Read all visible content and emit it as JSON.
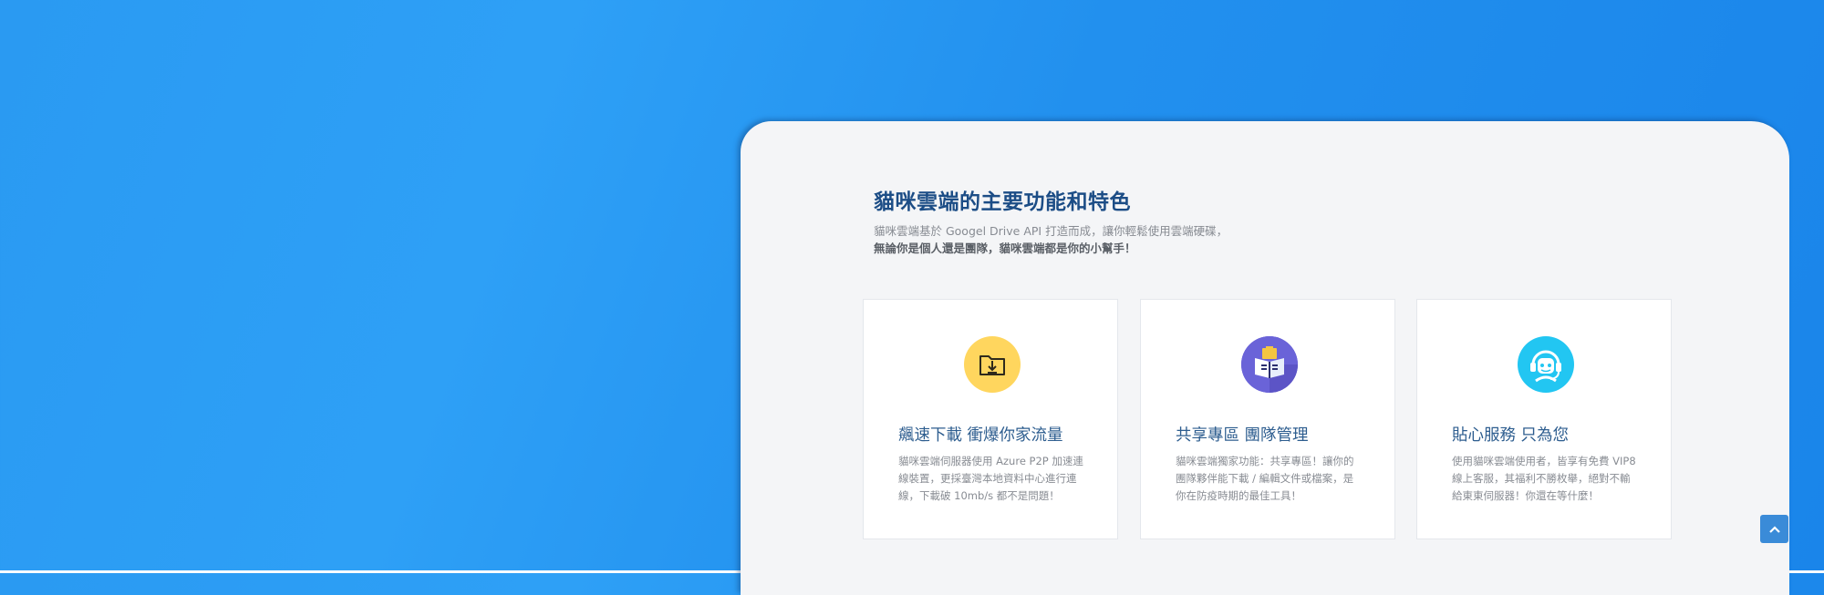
{
  "features": {
    "heading": "貓咪雲端的主要功能和特色",
    "intro_line1": "貓咪雲端基於 Googel Drive API 打造而成，讓你輕鬆使用雲端硬碟，",
    "intro_line2": "無論你是個人還是團隊，貓咪雲端都是你的小幫手！",
    "cards": [
      {
        "icon": "download-folder-icon",
        "icon_color": "#ffd65e",
        "title": "飆速下載 衝爆你家流量",
        "description": "貓咪雲端伺服器使用 Azure P2P 加速連線裝置，更採臺灣本地資料中心進行連線，下載破 10mb/s 都不是問題！"
      },
      {
        "icon": "book-folder-icon",
        "icon_color": "#6a63d8",
        "title": "共享專區 團隊管理",
        "description": "貓咪雲端獨家功能：共享專區！讓你的團隊夥伴能下載 / 編輯文件或檔案，是你在防疫時期的最佳工具！"
      },
      {
        "icon": "support-agent-icon",
        "icon_color": "#22c6f2",
        "title": "貼心服務 只為您",
        "description": "使用貓咪雲端使用者，皆享有免費 VIP8 線上客服，其福利不勝枚舉，絕對不輸給東東伺服器！你還在等什麼！"
      }
    ]
  },
  "back_to_top": {
    "icon": "chevron-up-icon"
  }
}
